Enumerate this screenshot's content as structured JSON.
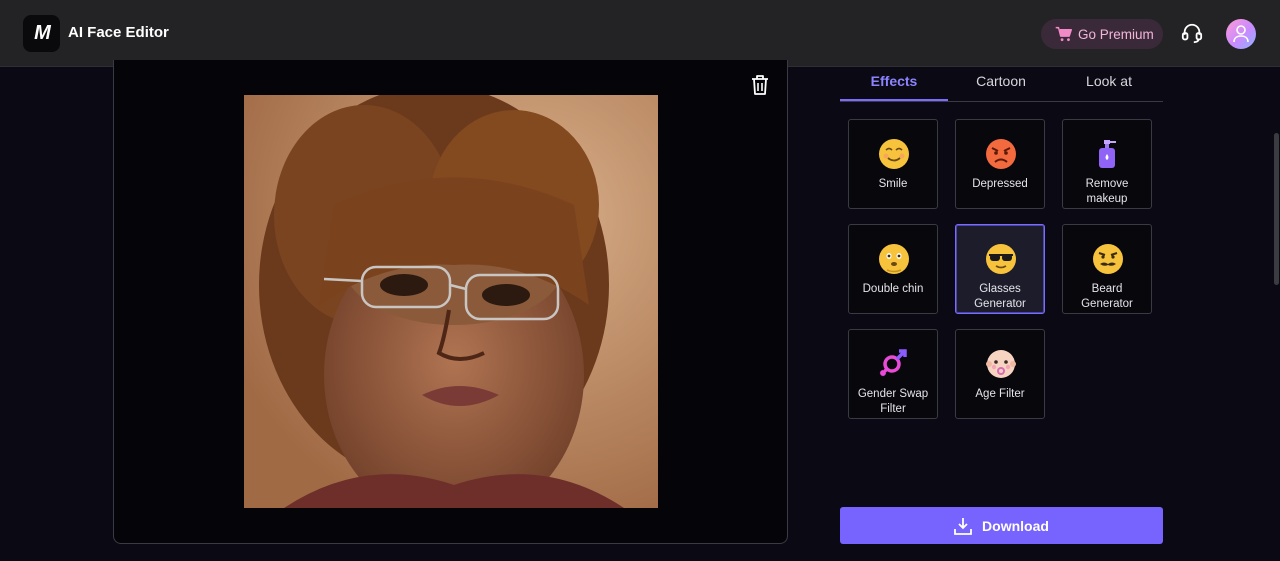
{
  "app": {
    "logo_text": "M",
    "title": "AI Face Editor"
  },
  "header": {
    "premium_label": "Go Premium"
  },
  "tabs": [
    {
      "label": "Effects",
      "active": true
    },
    {
      "label": "Cartoon",
      "active": false
    },
    {
      "label": "Look at",
      "active": false
    }
  ],
  "effects": [
    {
      "label": "Smile",
      "icon": "smile-emoji-icon"
    },
    {
      "label": "Depressed",
      "icon": "angry-emoji-icon"
    },
    {
      "label": "Remove makeup",
      "label_lines": [
        "Remove",
        "makeup"
      ],
      "icon": "pump-bottle-icon"
    },
    {
      "label": "Double chin",
      "icon": "double-chin-emoji-icon"
    },
    {
      "label": "Glasses Generator",
      "label_lines": [
        "Glasses",
        "Generator"
      ],
      "icon": "sunglasses-emoji-icon",
      "selected": true
    },
    {
      "label": "Beard Generator",
      "label_lines": [
        "Beard",
        "Generator"
      ],
      "icon": "beard-emoji-icon"
    },
    {
      "label": "Gender Swap Filter",
      "label_lines": [
        "Gender Swap",
        "Filter"
      ],
      "icon": "gender-symbol-icon"
    },
    {
      "label": "Age Filter",
      "icon": "baby-face-icon"
    }
  ],
  "download": {
    "label": "Download"
  },
  "colors": {
    "accent": "#7764ff",
    "tab_active": "#8b83ff",
    "premium_text": "#f2b5d9",
    "header_bg": "#232326"
  }
}
